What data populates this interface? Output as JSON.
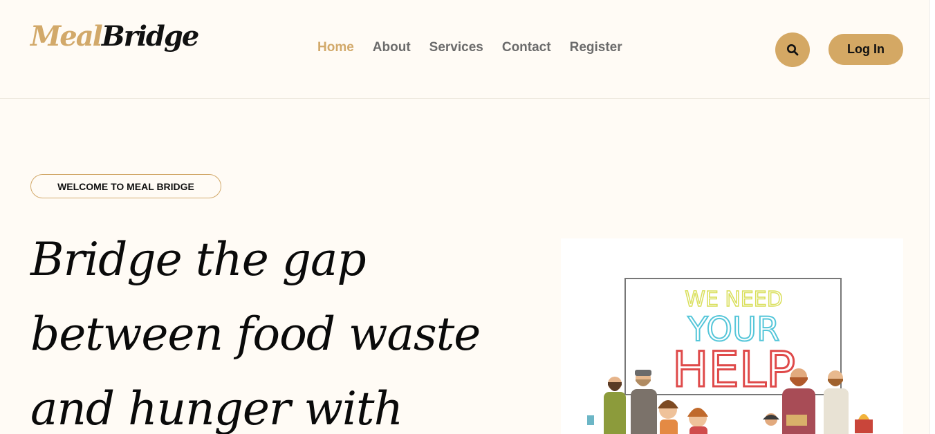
{
  "header": {
    "logo_part1": "Meal",
    "logo_part2": "Bridge",
    "nav": [
      {
        "label": "Home",
        "active": true
      },
      {
        "label": "About",
        "active": false
      },
      {
        "label": "Services",
        "active": false
      },
      {
        "label": "Contact",
        "active": false
      },
      {
        "label": "Register",
        "active": false
      }
    ],
    "search_icon": "search-icon",
    "login_label": "Log In"
  },
  "hero": {
    "badge": "WELCOME TO MEAL BRIDGE",
    "title_line1": "Bridge the gap",
    "title_line2": "between food waste",
    "title_line3": "and hunger with",
    "sign_line1": "WE NEED",
    "sign_line2": "YOUR",
    "sign_line3": "HELP"
  },
  "colors": {
    "accent": "#d4a864",
    "background": "#fffbf5",
    "text": "#111111",
    "nav_text": "#6b6b6b"
  }
}
